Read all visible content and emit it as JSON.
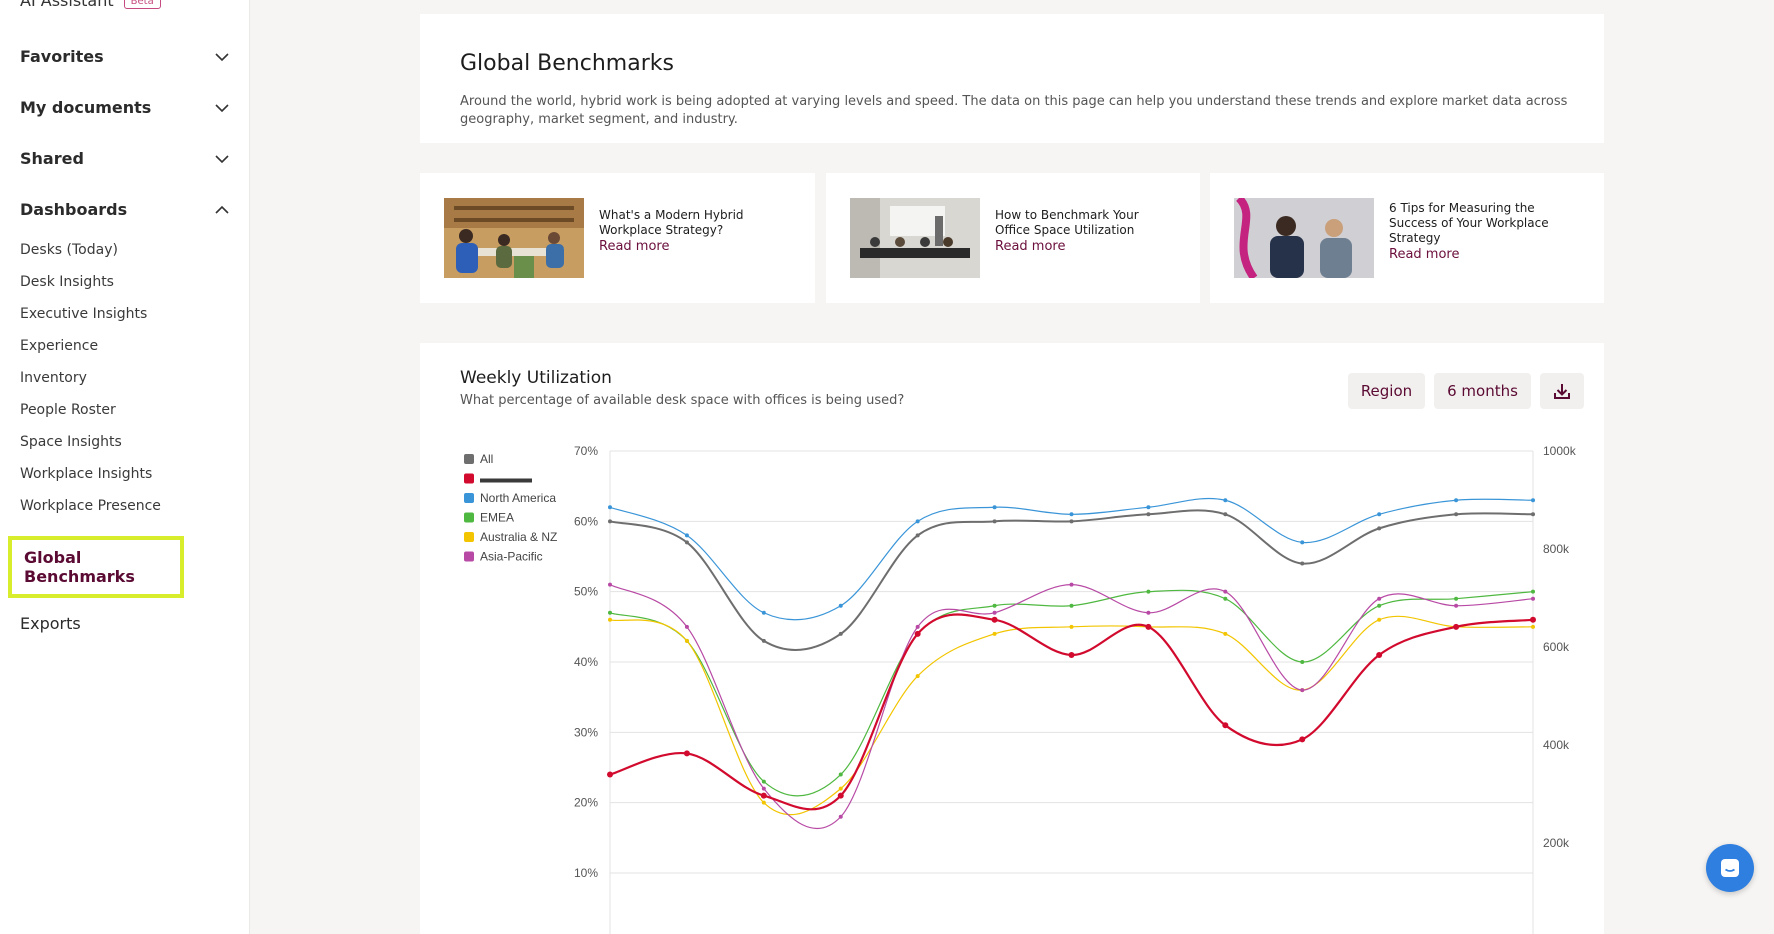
{
  "sidebar": {
    "top_item": "AI Assistant",
    "top_badge": "Beta",
    "sections": {
      "favorites": "Favorites",
      "my_documents": "My documents",
      "shared": "Shared",
      "dashboards": "Dashboards"
    },
    "dashboards": [
      "Desks (Today)",
      "Desk Insights",
      "Executive Insights",
      "Experience",
      "Inventory",
      "People Roster",
      "Space Insights",
      "Workplace Insights",
      "Workplace Presence"
    ],
    "active": "Global Benchmarks",
    "exports": "Exports"
  },
  "intro": {
    "title": "Global Benchmarks",
    "description": "Around the world, hybrid work is being adopted at varying levels and speed. The data on this page can help you understand these trends and explore market data across geography, market segment, and industry."
  },
  "articles": [
    {
      "title": "What's a Modern Hybrid Workplace Strategy?",
      "link": "Read more"
    },
    {
      "title": "How to Benchmark Your Office Space Utilization",
      "link": "Read more"
    },
    {
      "title": "6 Tips for Measuring the Success of Your Workplace Strategy",
      "link": "Read more"
    }
  ],
  "chart_card": {
    "title": "Weekly Utilization",
    "subtitle": "What percentage of available desk space with offices is being used?",
    "region_button": "Region",
    "period_button": "6 months",
    "download_icon": "download-icon"
  },
  "chart_data": {
    "type": "line",
    "y_ticks": [
      "70%",
      "60%",
      "50%",
      "40%",
      "30%",
      "20%",
      "10%"
    ],
    "y2_ticks": [
      "1000k",
      "800k",
      "600k",
      "400k",
      "200k"
    ],
    "ylim": [
      0,
      70
    ],
    "grid": true,
    "legend_position": "top-left",
    "series": [
      {
        "name": "All",
        "color": "#6e6e6e",
        "values": [
          60,
          57,
          43,
          44,
          58,
          60,
          60,
          61,
          61,
          54,
          59,
          61,
          61
        ]
      },
      {
        "name": "",
        "color": "#d10a2e",
        "values": [
          24,
          27,
          21,
          21,
          44,
          46,
          41,
          45,
          31,
          29,
          41,
          45,
          46
        ]
      },
      {
        "name": "North America",
        "color": "#3a95d8",
        "values": [
          62,
          58,
          47,
          48,
          60,
          62,
          61,
          62,
          63,
          57,
          61,
          63,
          63
        ]
      },
      {
        "name": "EMEA",
        "color": "#4fb840",
        "values": [
          47,
          43,
          23,
          24,
          44,
          48,
          48,
          50,
          49,
          40,
          48,
          49,
          50
        ]
      },
      {
        "name": "Australia & NZ",
        "color": "#f2c500",
        "values": [
          46,
          43,
          20,
          22,
          38,
          44,
          45,
          45,
          44,
          36,
          46,
          45,
          45
        ]
      },
      {
        "name": "Asia-Pacific",
        "color": "#b84aa5",
        "values": [
          51,
          45,
          22,
          18,
          45,
          47,
          51,
          47,
          50,
          36,
          49,
          48,
          49
        ]
      }
    ]
  }
}
